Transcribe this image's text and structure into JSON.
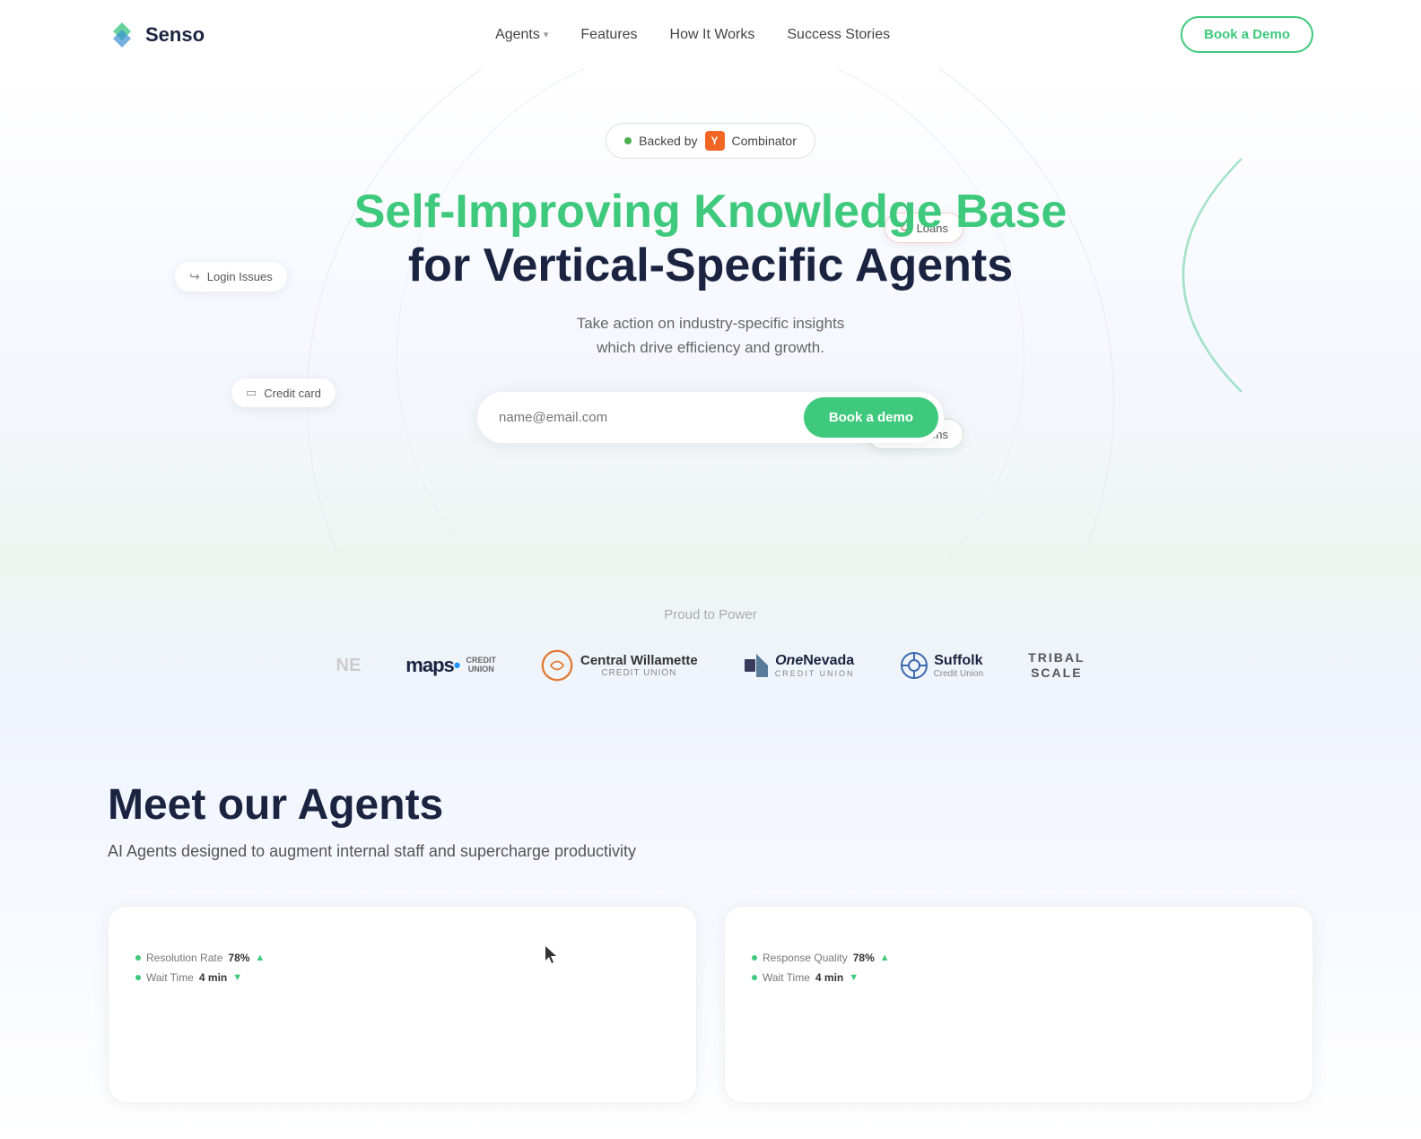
{
  "nav": {
    "logo_text": "Senso",
    "agents_label": "Agents",
    "features_label": "Features",
    "how_it_works_label": "How It Works",
    "success_stories_label": "Success Stories",
    "book_demo_label": "Book a Demo"
  },
  "hero": {
    "yc_badge_dot": "",
    "yc_badge_text": "Backed by",
    "yc_logo_text": "Y",
    "yc_combinator": "Combinator",
    "title_green": "Self-Improving Knowledge Base",
    "title_dark": "for Vertical-Specific Agents",
    "subtitle_line1": "Take action on industry-specific insights",
    "subtitle_line2": "which drive efficiency and growth.",
    "email_placeholder": "name@email.com",
    "cta_label": "Book a demo"
  },
  "floating_badges": {
    "login_issues": "Login Issues",
    "credit_card": "Credit card",
    "loans": "Loans",
    "emotions": "Emotions"
  },
  "proud": {
    "label": "Proud to Power",
    "partners": [
      {
        "name": "maps_credit_union",
        "display": "maps",
        "type": "maps"
      },
      {
        "name": "central_willamette",
        "display": "Central Willamette",
        "sub": "CREDIT UNION",
        "type": "cw"
      },
      {
        "name": "one_nevada",
        "display": "OneNevada",
        "sub": "CREDIT UNION",
        "type": "on"
      },
      {
        "name": "suffolk",
        "display": "Suffolk",
        "sub": "Credit Union",
        "type": "suffolk"
      },
      {
        "name": "tribal_scale",
        "display": "TRIBAL SCALE",
        "type": "ts"
      }
    ]
  },
  "agents_section": {
    "title": "Meet our Agents",
    "subtitle": "AI Agents designed to augment internal staff and supercharge productivity"
  },
  "agent_cards": [
    {
      "stats": [
        {
          "label": "Resolution Rate",
          "value": "78%",
          "trend": "up"
        },
        {
          "label": "Wait Time",
          "value": "4 min",
          "trend": "down"
        }
      ]
    },
    {
      "stats": [
        {
          "label": "Response Quality",
          "value": "78%",
          "trend": "up"
        },
        {
          "label": "Wait Time",
          "value": "4 min",
          "trend": "down"
        }
      ]
    }
  ]
}
